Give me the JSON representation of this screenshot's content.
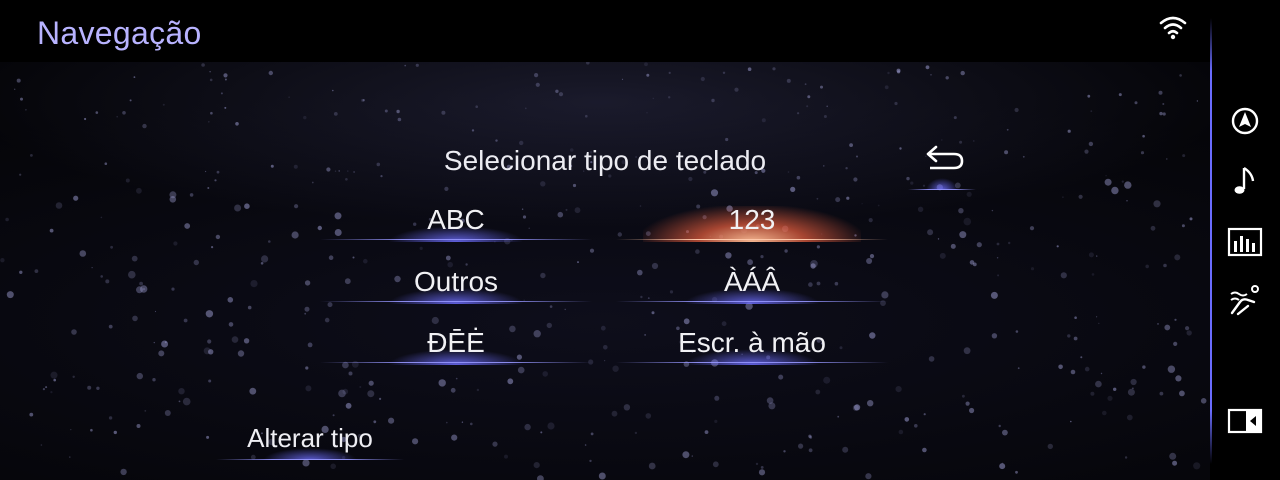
{
  "header": {
    "title": "Navegação",
    "status_icon": "wifi-icon"
  },
  "keyboard_select": {
    "heading": "Selecionar tipo de teclado",
    "back_icon": "back-arrow-icon",
    "options": [
      {
        "label": "ABC",
        "selected": false
      },
      {
        "label": "123",
        "selected": true
      },
      {
        "label": "Outros",
        "selected": false
      },
      {
        "label": "ÀÁÂ",
        "selected": false
      },
      {
        "label": "ĐĒĖ",
        "selected": false
      },
      {
        "label": "Escr. à mão",
        "selected": false
      }
    ],
    "change_type_label": "Alterar tipo"
  },
  "side_rail": {
    "icons": [
      "navigation-compass-icon",
      "music-note-icon",
      "equalizer-icon",
      "climate-seat-icon",
      "screen-split-icon"
    ]
  },
  "colors": {
    "title": "#b8b3ff",
    "accent": "#6a6cff",
    "selected_glow": "#e0705a",
    "text": "#f1f1f4"
  }
}
